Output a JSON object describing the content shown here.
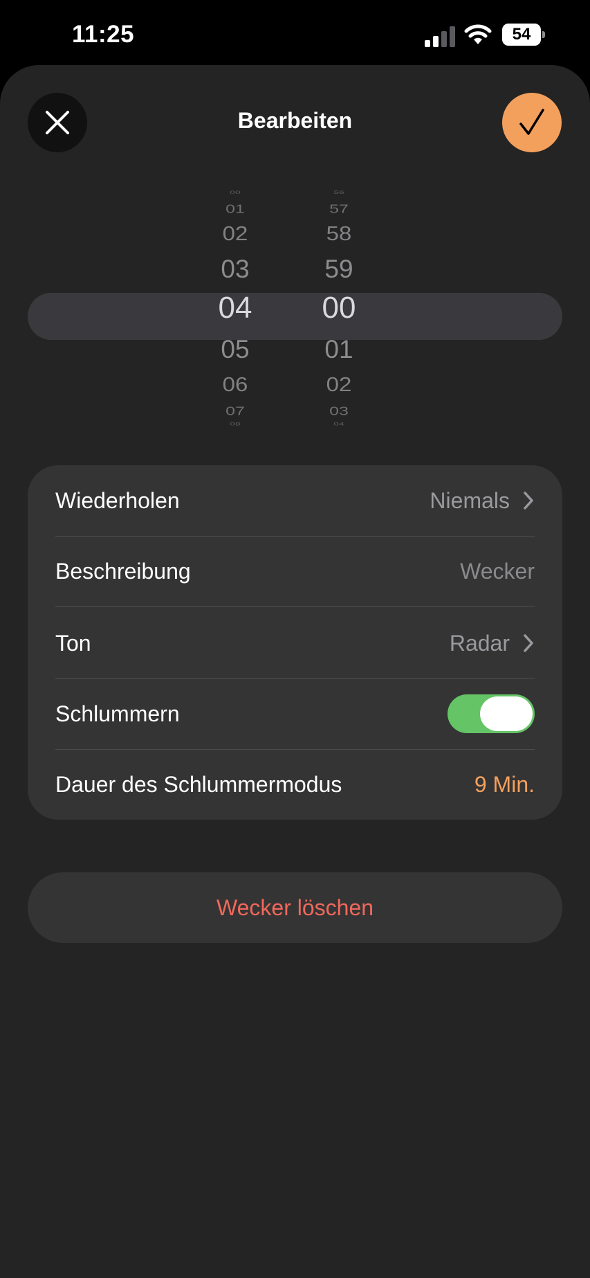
{
  "status_bar": {
    "time": "11:25",
    "battery": "54"
  },
  "header": {
    "title": "Bearbeiten",
    "close_icon": "close-icon",
    "confirm_icon": "checkmark-icon",
    "accent_color": "#f4a05d"
  },
  "time_picker": {
    "hours": [
      "00",
      "01",
      "02",
      "03",
      "04",
      "05",
      "06",
      "07",
      "08"
    ],
    "minutes": [
      "56",
      "57",
      "58",
      "59",
      "00",
      "01",
      "02",
      "03",
      "04"
    ],
    "selected_hour": "04",
    "selected_minute": "00"
  },
  "settings": {
    "repeat": {
      "label": "Wiederholen",
      "value": "Niemals"
    },
    "description": {
      "label": "Beschreibung",
      "placeholder": "Wecker"
    },
    "sound": {
      "label": "Ton",
      "value": "Radar"
    },
    "snooze": {
      "label": "Schlummern",
      "enabled": true
    },
    "snooze_duration": {
      "label": "Dauer des Schlummermodus",
      "value": "9 Min."
    }
  },
  "delete_button": {
    "label": "Wecker löschen",
    "color": "#f0685c"
  }
}
